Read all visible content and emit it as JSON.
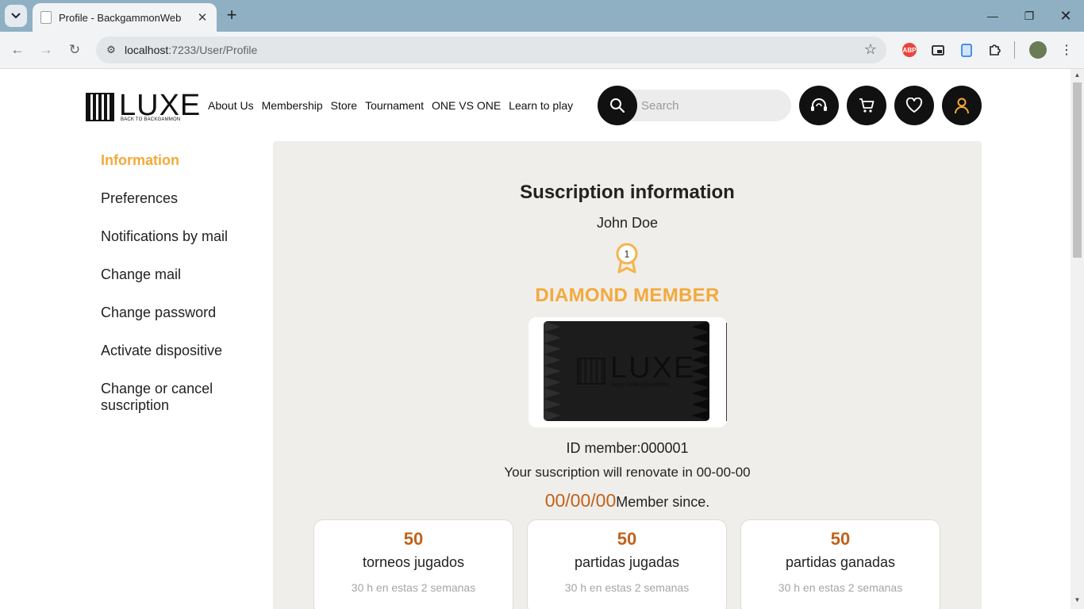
{
  "browser": {
    "tab_title": "Profile - BackgammonWeb",
    "url_host": "localhost",
    "url_path": ":7233/User/Profile",
    "abp_label": "ABP"
  },
  "header": {
    "logo_word": "LUXE",
    "logo_tagline": "BACK TO BACKGAMMON",
    "nav": [
      "About Us",
      "Membership",
      "Store",
      "Tournament",
      "ONE VS ONE",
      "Learn to play"
    ],
    "search_placeholder": "Search",
    "icons": [
      "search-icon",
      "support-icon",
      "cart-icon",
      "heart-icon",
      "user-icon"
    ]
  },
  "sidebar": {
    "items": [
      {
        "label": "Information",
        "active": true
      },
      {
        "label": "Preferences"
      },
      {
        "label": "Notifications by mail"
      },
      {
        "label": "Change mail"
      },
      {
        "label": "Change password"
      },
      {
        "label": "Activate dispositive"
      },
      {
        "label": "Change or cancel suscription"
      }
    ]
  },
  "profile": {
    "title": "Suscription information",
    "name": "John Doe",
    "medal_rank": "1",
    "tier": "DIAMOND MEMBER",
    "card_word": "LUXE",
    "card_tagline": "BACK TO BACKGAMMON",
    "id_member": "ID member:000001",
    "renovate": "Your suscription will renovate in 00-00-00",
    "since_date": "00/00/00",
    "since_label": "Member since."
  },
  "stats": [
    {
      "value": "50",
      "label": "torneos jugados",
      "sub": "30 h en estas 2 semanas"
    },
    {
      "value": "50",
      "label": "partidas jugadas",
      "sub": "30 h en estas 2 semanas"
    },
    {
      "value": "50",
      "label": "partidas ganadas",
      "sub": "30 h en estas 2 semanas"
    }
  ],
  "colors": {
    "accent": "#f4a93a",
    "number": "#c0621a",
    "panel": "#efeeeb",
    "dark": "#111111"
  }
}
